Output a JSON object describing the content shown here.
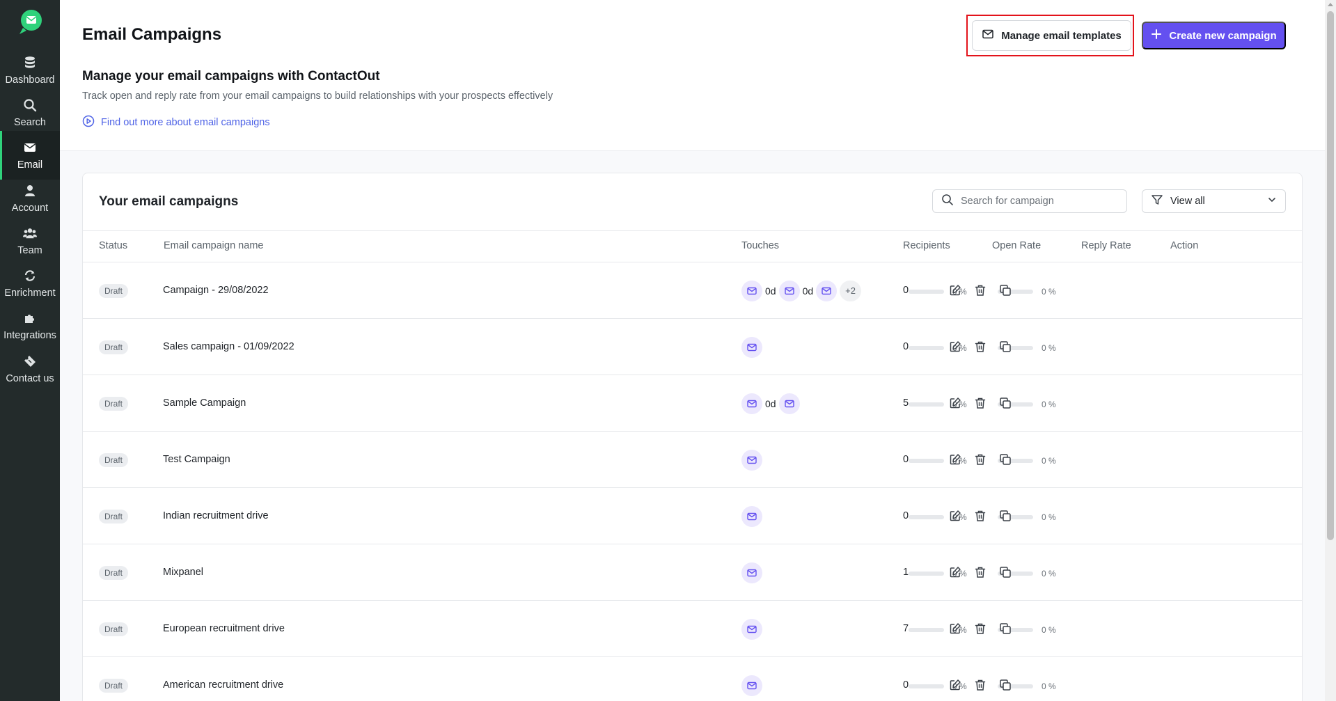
{
  "sidebar": {
    "items": [
      {
        "label": "Dashboard",
        "icon": "database-icon"
      },
      {
        "label": "Search",
        "icon": "search-icon"
      },
      {
        "label": "Email",
        "icon": "mail-icon"
      },
      {
        "label": "Account",
        "icon": "user-icon"
      },
      {
        "label": "Team",
        "icon": "users-icon"
      },
      {
        "label": "Enrichment",
        "icon": "refresh-icon"
      },
      {
        "label": "Integrations",
        "icon": "puzzle-icon"
      },
      {
        "label": "Contact us",
        "icon": "ticket-icon"
      }
    ],
    "active": "Email",
    "accent": "#2fd27b"
  },
  "header": {
    "title": "Email Campaigns",
    "manage_templates_label": "Manage email templates",
    "create_campaign_label": "Create new campaign"
  },
  "intro": {
    "subtitle": "Manage your email campaigns with ContactOut",
    "description": "Track open and reply rate from your email campaigns to build relationships with your prospects effectively",
    "link_label": "Find out more about email campaigns"
  },
  "campaigns_panel": {
    "title": "Your email campaigns",
    "search_placeholder": "Search for campaign",
    "filter_label": "View all",
    "columns": [
      "Status",
      "Email campaign name",
      "Touches",
      "Recipients",
      "Open Rate",
      "Reply Rate",
      "Action"
    ],
    "rows": [
      {
        "status": "Draft",
        "name": "Campaign - 29/08/2022",
        "touches": [
          {
            "delay": "0d"
          },
          {
            "delay": "0d"
          },
          {
            "delay": ""
          }
        ],
        "more": "+2",
        "recipients": "0",
        "open_rate": "0 %",
        "open_fraction": 0,
        "reply_rate": "0 %",
        "reply_fraction": 0
      },
      {
        "status": "Draft",
        "name": "Sales campaign - 01/09/2022",
        "touches": [
          {
            "delay": ""
          }
        ],
        "more": "",
        "recipients": "0",
        "open_rate": "0 %",
        "open_fraction": 0,
        "reply_rate": "0 %",
        "reply_fraction": 0
      },
      {
        "status": "Draft",
        "name": "Sample Campaign",
        "touches": [
          {
            "delay": "0d"
          },
          {
            "delay": ""
          }
        ],
        "more": "",
        "recipients": "5",
        "open_rate": "0 %",
        "open_fraction": 0,
        "reply_rate": "0 %",
        "reply_fraction": 0
      },
      {
        "status": "Draft",
        "name": "Test Campaign",
        "touches": [
          {
            "delay": ""
          }
        ],
        "more": "",
        "recipients": "0",
        "open_rate": "0 %",
        "open_fraction": 0,
        "reply_rate": "0 %",
        "reply_fraction": 0
      },
      {
        "status": "Draft",
        "name": "Indian recruitment drive",
        "touches": [
          {
            "delay": ""
          }
        ],
        "more": "",
        "recipients": "0",
        "open_rate": "0 %",
        "open_fraction": 0,
        "reply_rate": "0 %",
        "reply_fraction": 0
      },
      {
        "status": "Draft",
        "name": "Mixpanel",
        "touches": [
          {
            "delay": ""
          }
        ],
        "more": "",
        "recipients": "1",
        "open_rate": "0 %",
        "open_fraction": 0,
        "reply_rate": "0 %",
        "reply_fraction": 0
      },
      {
        "status": "Draft",
        "name": "European recruitment drive",
        "touches": [
          {
            "delay": ""
          }
        ],
        "more": "",
        "recipients": "7",
        "open_rate": "0 %",
        "open_fraction": 0,
        "reply_rate": "0 %",
        "reply_fraction": 0
      },
      {
        "status": "Draft",
        "name": "American recruitment drive",
        "touches": [
          {
            "delay": ""
          }
        ],
        "more": "",
        "recipients": "0",
        "open_rate": "0 %",
        "open_fraction": 0,
        "reply_rate": "0 %",
        "reply_fraction": 0
      }
    ]
  },
  "colors": {
    "primary": "#6450f0",
    "highlight": "#e3131b",
    "link": "#4f63e6"
  }
}
